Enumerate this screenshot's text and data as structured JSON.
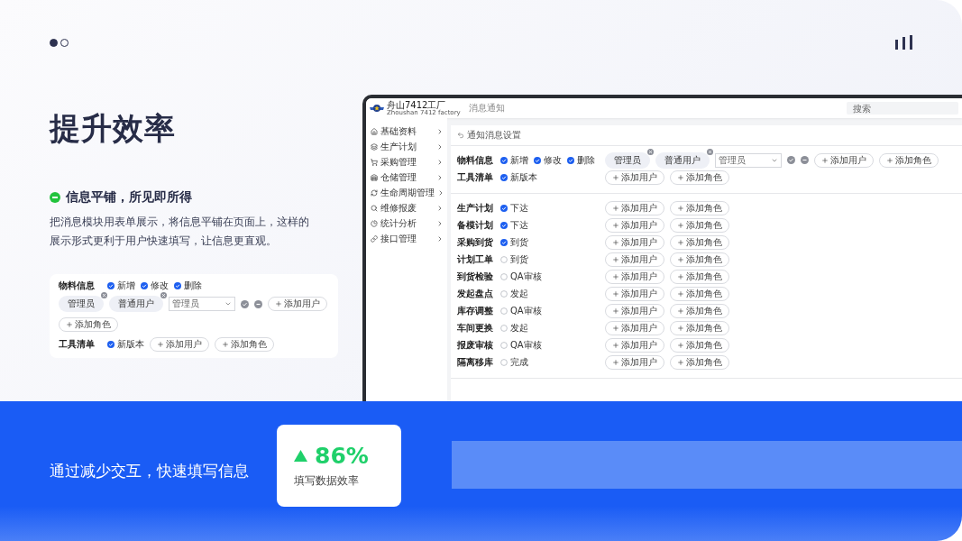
{
  "pager": [
    {
      "selected": true
    },
    {
      "selected": false
    }
  ],
  "title": "提升效率",
  "feature": {
    "heading": "信息平铺，所见即所得",
    "description": "把消息模块用表单展示，将信息平铺在页面上，这样的展示形式更利于用户快速填写，让信息更直观。"
  },
  "preview": {
    "rows": [
      {
        "label": "物料信息",
        "options": [
          {
            "label": "新增",
            "checked": true
          },
          {
            "label": "修改",
            "checked": true
          },
          {
            "label": "删除",
            "checked": true
          }
        ],
        "tags": [
          "管理员",
          "普通用户"
        ],
        "select": {
          "value": "管理员"
        },
        "buttons": [
          "添加用户",
          "添加角色"
        ]
      },
      {
        "label": "工具清单",
        "options": [
          {
            "label": "新版本",
            "checked": true
          }
        ],
        "buttons": [
          "添加用户",
          "添加角色"
        ]
      }
    ]
  },
  "app": {
    "logo": {
      "name": "舟山7412工厂",
      "subtitle": "Zhoushan 7412 factory"
    },
    "breadcrumb": "消息通知",
    "search": {
      "placeholder": "搜索"
    },
    "sidebar": [
      "基础资料",
      "生产计划",
      "采购管理",
      "仓储管理",
      "生命周期管理",
      "维修报废",
      "统计分析",
      "接口管理"
    ],
    "page_title": "通知消息设置",
    "sections": [
      {
        "rows": [
          {
            "label": "物料信息",
            "options": [
              {
                "label": "新增",
                "checked": true
              },
              {
                "label": "修改",
                "checked": true
              },
              {
                "label": "删除",
                "checked": true
              }
            ],
            "tags": [
              "管理员",
              "普通用户"
            ],
            "select": {
              "value": "管理员"
            },
            "buttons": [
              "添加用户",
              "添加角色"
            ]
          },
          {
            "label": "工具清单",
            "options": [
              {
                "label": "新版本",
                "checked": true
              }
            ],
            "buttons": [
              "添加用户",
              "添加角色"
            ]
          }
        ]
      },
      {
        "rows": [
          {
            "label": "生产计划",
            "options": [
              {
                "label": "下达",
                "checked": true
              }
            ],
            "buttons": [
              "添加用户",
              "添加角色"
            ]
          },
          {
            "label": "备模计划",
            "options": [
              {
                "label": "下达",
                "checked": true
              }
            ],
            "buttons": [
              "添加用户",
              "添加角色"
            ]
          },
          {
            "label": "采购到货",
            "options": [
              {
                "label": "到货",
                "checked": true
              }
            ],
            "buttons": [
              "添加用户",
              "添加角色"
            ]
          },
          {
            "label": "计划工单",
            "options": [
              {
                "label": "到货",
                "checked": false
              }
            ],
            "buttons": [
              "添加用户",
              "添加角色"
            ]
          },
          {
            "label": "到货检验",
            "options": [
              {
                "label": "QA审核",
                "checked": false
              }
            ],
            "buttons": [
              "添加用户",
              "添加角色"
            ]
          },
          {
            "label": "发起盘点",
            "options": [
              {
                "label": "发起",
                "checked": false
              }
            ],
            "buttons": [
              "添加用户",
              "添加角色"
            ]
          },
          {
            "label": "库存调整",
            "options": [
              {
                "label": "QA审核",
                "checked": false
              }
            ],
            "buttons": [
              "添加用户",
              "添加角色"
            ]
          },
          {
            "label": "车间更换",
            "options": [
              {
                "label": "发起",
                "checked": false
              }
            ],
            "buttons": [
              "添加用户",
              "添加角色"
            ]
          },
          {
            "label": "报废审核",
            "options": [
              {
                "label": "QA审核",
                "checked": false
              }
            ],
            "buttons": [
              "添加用户",
              "添加角色"
            ]
          },
          {
            "label": "隔离移库",
            "options": [
              {
                "label": "完成",
                "checked": false
              }
            ],
            "buttons": [
              "添加用户",
              "添加角色"
            ]
          }
        ]
      }
    ]
  },
  "banner": {
    "text": "通过减少交互，快速填写信息",
    "stat": {
      "value": "86%",
      "label": "填写数据效率"
    }
  }
}
